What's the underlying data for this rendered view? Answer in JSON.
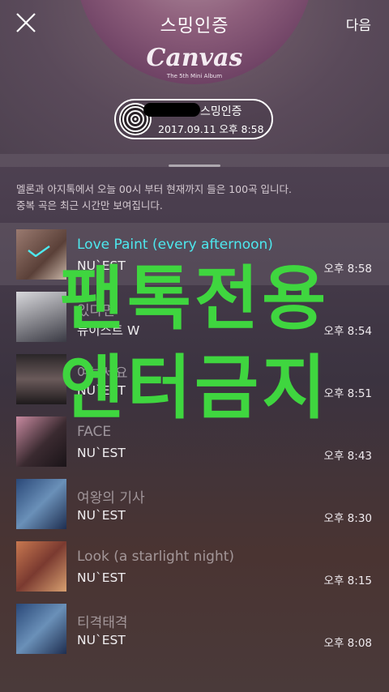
{
  "header": {
    "close_icon": "close-icon",
    "next_label": "다음",
    "disc_title": "스밍인증",
    "disc_logo": "Canvas",
    "disc_subtitle": "The 5th Mini Album"
  },
  "badge": {
    "icon": "disc-icon",
    "title": "스밍인증",
    "date": "2017.09.11 오후 8:58"
  },
  "info": {
    "line1": "멜론과 아지톡에서 오늘 00시 부터 현재까지 들은 100곡 입니다.",
    "line2": "중복 곡은 최근 시간만 보여집니다."
  },
  "songs": [
    {
      "title": "Love Paint (every afternoon)",
      "artist": "NU`EST",
      "time": "오후 8:58",
      "selected": true
    },
    {
      "title": "있다면",
      "artist": "뉴이스트 W",
      "time": "오후 8:54"
    },
    {
      "title": "여보세요",
      "artist": "NU`EST",
      "time": "오후 8:51"
    },
    {
      "title": "FACE",
      "artist": "NU`EST",
      "time": "오후 8:43"
    },
    {
      "title": "여왕의 기사",
      "artist": "NU`EST",
      "time": "오후 8:30"
    },
    {
      "title": "Look (a starlight night)",
      "artist": "NU`EST",
      "time": "오후 8:15"
    },
    {
      "title": "티격태격",
      "artist": "NU`EST",
      "time": "오후 8:08"
    }
  ],
  "watermark": {
    "line1": "팬톡전용",
    "line2": "엔터금지",
    "color": "#3fd63f"
  },
  "colors": {
    "selected_title": "#4de8ee"
  }
}
